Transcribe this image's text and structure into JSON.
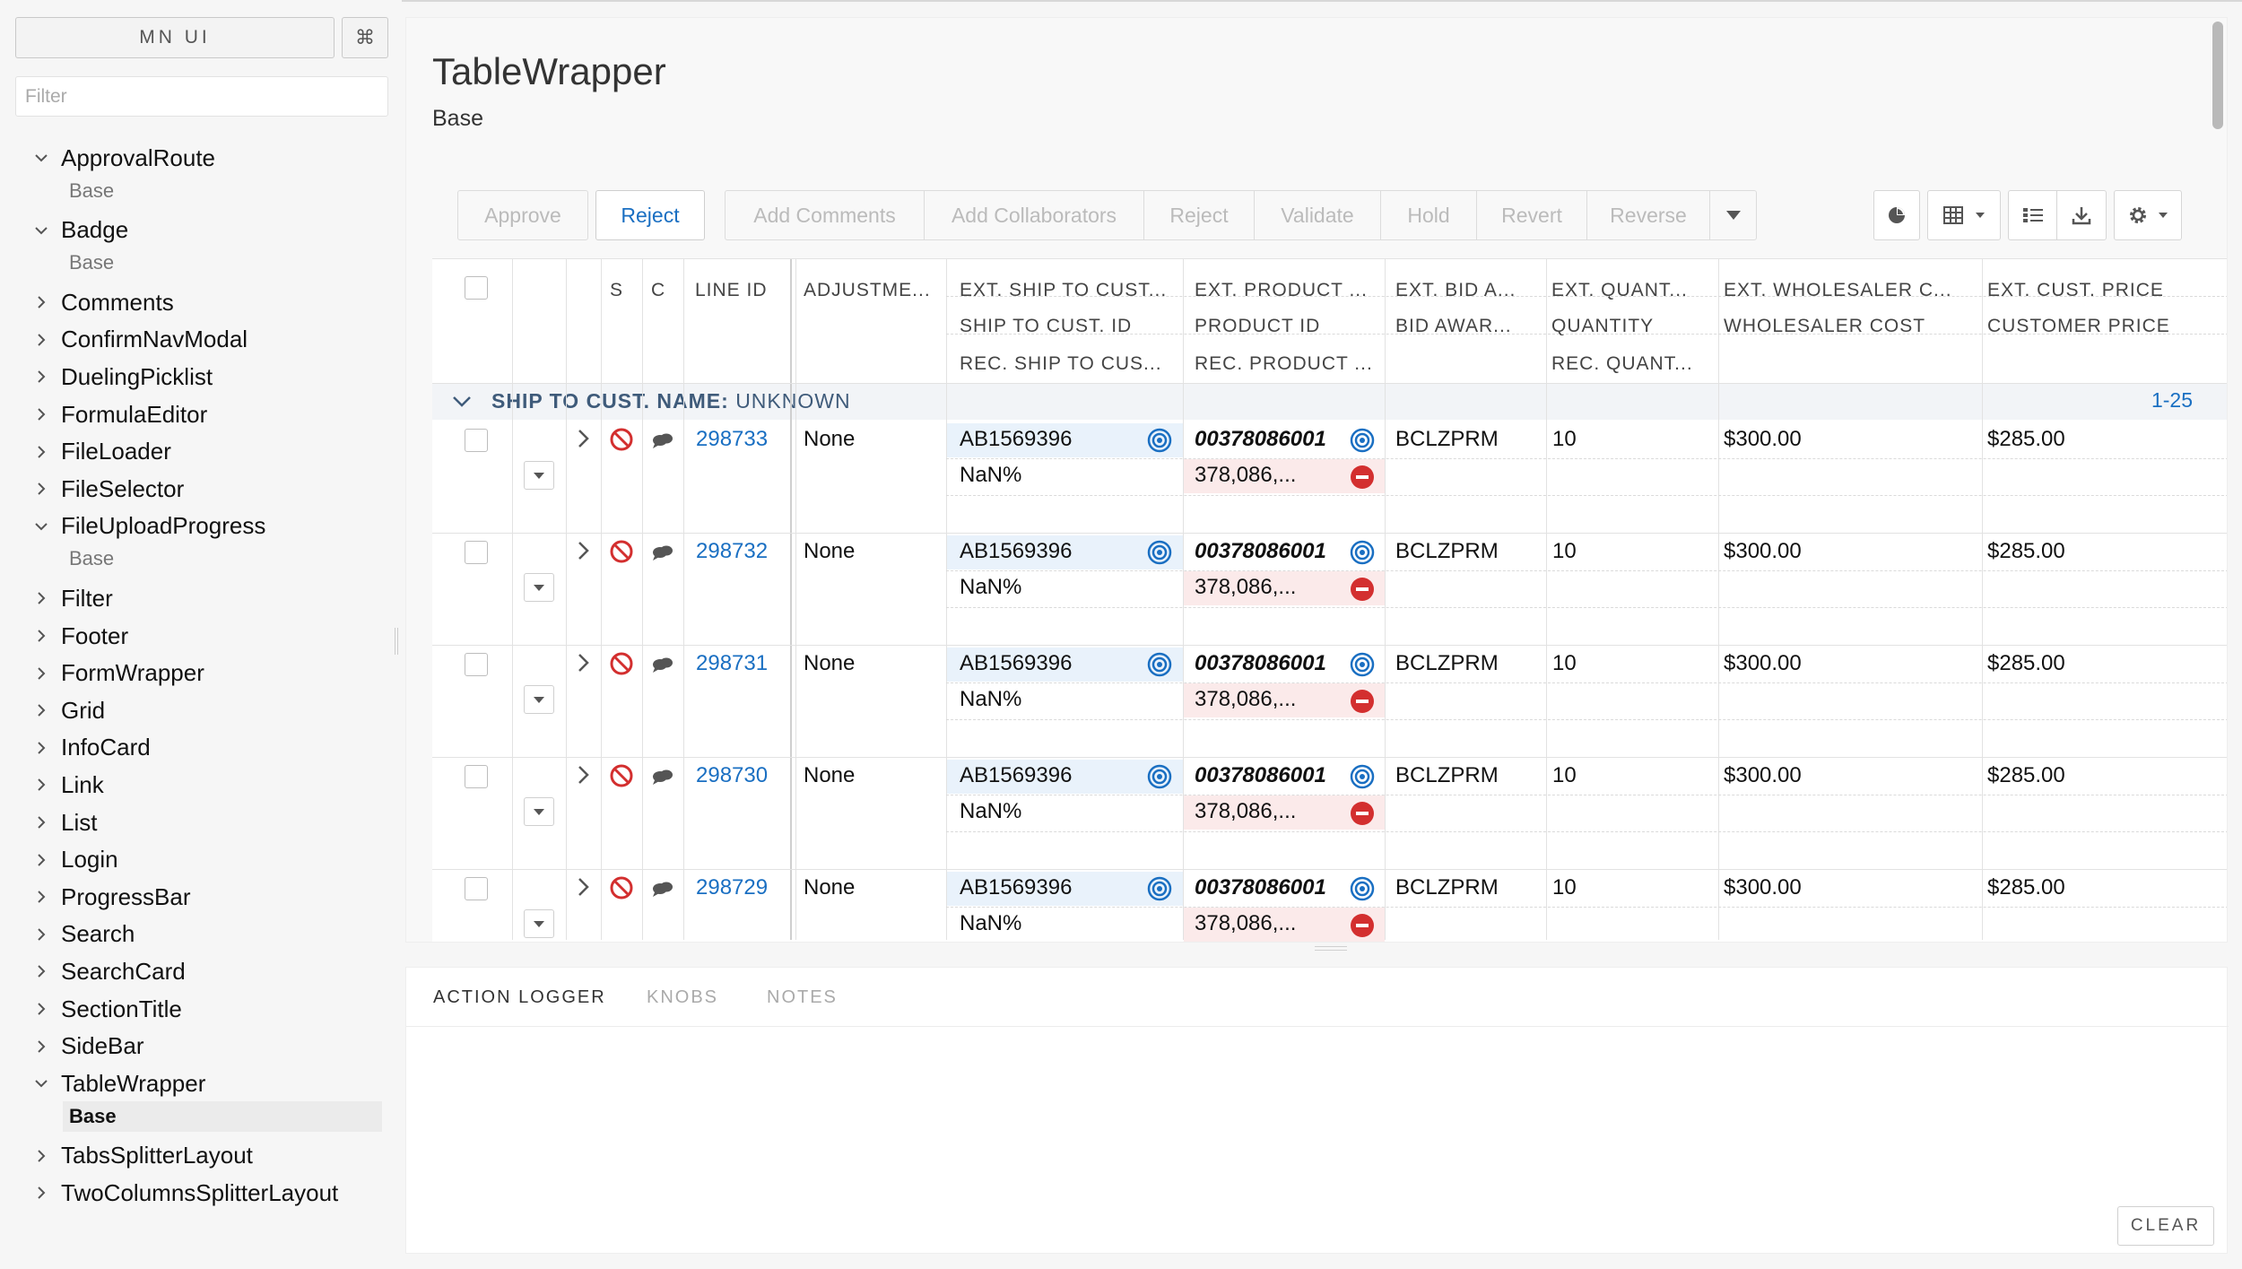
{
  "sidebar": {
    "title": "MN UI",
    "shortcut": "⌘",
    "filter_placeholder": "Filter",
    "items": [
      {
        "label": "ApprovalRoute",
        "expanded": true,
        "children": [
          "Base"
        ]
      },
      {
        "label": "Badge",
        "expanded": true,
        "children": [
          "Base"
        ]
      },
      {
        "label": "Comments",
        "expanded": false
      },
      {
        "label": "ConfirmNavModal",
        "expanded": false
      },
      {
        "label": "DuelingPicklist",
        "expanded": false
      },
      {
        "label": "FormulaEditor",
        "expanded": false
      },
      {
        "label": "FileLoader",
        "expanded": false
      },
      {
        "label": "FileSelector",
        "expanded": false
      },
      {
        "label": "FileUploadProgress",
        "expanded": true,
        "children": [
          "Base"
        ]
      },
      {
        "label": "Filter",
        "expanded": false
      },
      {
        "label": "Footer",
        "expanded": false
      },
      {
        "label": "FormWrapper",
        "expanded": false
      },
      {
        "label": "Grid",
        "expanded": false
      },
      {
        "label": "InfoCard",
        "expanded": false
      },
      {
        "label": "Link",
        "expanded": false
      },
      {
        "label": "List",
        "expanded": false
      },
      {
        "label": "Login",
        "expanded": false
      },
      {
        "label": "ProgressBar",
        "expanded": false
      },
      {
        "label": "Search",
        "expanded": false
      },
      {
        "label": "SearchCard",
        "expanded": false
      },
      {
        "label": "SectionTitle",
        "expanded": false
      },
      {
        "label": "SideBar",
        "expanded": false
      },
      {
        "label": "TableWrapper",
        "expanded": true,
        "children": [
          "Base"
        ],
        "active_child": 0
      },
      {
        "label": "TabsSplitterLayout",
        "expanded": false
      },
      {
        "label": "TwoColumnsSplitterLayout",
        "expanded": false
      }
    ]
  },
  "main": {
    "title": "TableWrapper",
    "subtitle": "Base"
  },
  "toolbar": {
    "approve": "Approve",
    "reject": "Reject",
    "group_actions": [
      "Add Comments",
      "Add Collaborators",
      "Reject",
      "Validate",
      "Hold",
      "Revert",
      "Reverse"
    ]
  },
  "table": {
    "headers": {
      "s": "S",
      "c": "C",
      "line_id": "LINE ID",
      "adjustment": "ADJUSTME...",
      "ship_to": [
        "EXT. SHIP TO CUST...",
        "SHIP TO CUST. ID",
        "REC. SHIP TO CUS..."
      ],
      "product": [
        "EXT. PRODUCT ...",
        "PRODUCT ID",
        "REC. PRODUCT ..."
      ],
      "bid": [
        "EXT. BID A...",
        "BID AWAR..."
      ],
      "quantity": [
        "EXT. QUANT...",
        "QUANTITY",
        "REC. QUANT..."
      ],
      "wholesaler": [
        "EXT. WHOLESALER C...",
        "WHOLESALER COST"
      ],
      "cust_price": [
        "EXT. CUST. PRICE",
        "CUSTOMER PRICE"
      ]
    },
    "group": {
      "label": "SHIP TO CUST. NAME:",
      "value": "UNKNOWN",
      "range": "1-25"
    },
    "rows": [
      {
        "line_id": "298733",
        "adjustment": "None",
        "ship_to_id": "AB1569396",
        "ship_to_pct": "NaN%",
        "product_id": "00378086001",
        "product_rec": "378,086,...",
        "bid": "BCLZPRM",
        "quantity": "10",
        "wholesaler": "$300.00",
        "cust_price": "$285.00"
      },
      {
        "line_id": "298732",
        "adjustment": "None",
        "ship_to_id": "AB1569396",
        "ship_to_pct": "NaN%",
        "product_id": "00378086001",
        "product_rec": "378,086,...",
        "bid": "BCLZPRM",
        "quantity": "10",
        "wholesaler": "$300.00",
        "cust_price": "$285.00"
      },
      {
        "line_id": "298731",
        "adjustment": "None",
        "ship_to_id": "AB1569396",
        "ship_to_pct": "NaN%",
        "product_id": "00378086001",
        "product_rec": "378,086,...",
        "bid": "BCLZPRM",
        "quantity": "10",
        "wholesaler": "$300.00",
        "cust_price": "$285.00"
      },
      {
        "line_id": "298730",
        "adjustment": "None",
        "ship_to_id": "AB1569396",
        "ship_to_pct": "NaN%",
        "product_id": "00378086001",
        "product_rec": "378,086,...",
        "bid": "BCLZPRM",
        "quantity": "10",
        "wholesaler": "$300.00",
        "cust_price": "$285.00"
      },
      {
        "line_id": "298729",
        "adjustment": "None",
        "ship_to_id": "AB1569396",
        "ship_to_pct": "NaN%",
        "product_id": "00378086001",
        "product_rec": "378,086,...",
        "bid": "BCLZPRM",
        "quantity": "10",
        "wholesaler": "$300.00",
        "cust_price": "$285.00"
      }
    ]
  },
  "bottom_panel": {
    "tabs": [
      "ACTION LOGGER",
      "KNOBS",
      "NOTES"
    ],
    "active_tab": 0,
    "clear": "CLEAR"
  },
  "colors": {
    "accent": "#1a6fc2",
    "status_red": "#d32f2f",
    "group_text": "#3f5b7a"
  },
  "icons": {
    "row_expand": "chevron-right-icon",
    "status": "no-entry-icon",
    "comments": "chat-bubbles-icon",
    "target": "target-icon",
    "remove": "minus-circle-icon",
    "row_menu": "caret-down-icon"
  }
}
